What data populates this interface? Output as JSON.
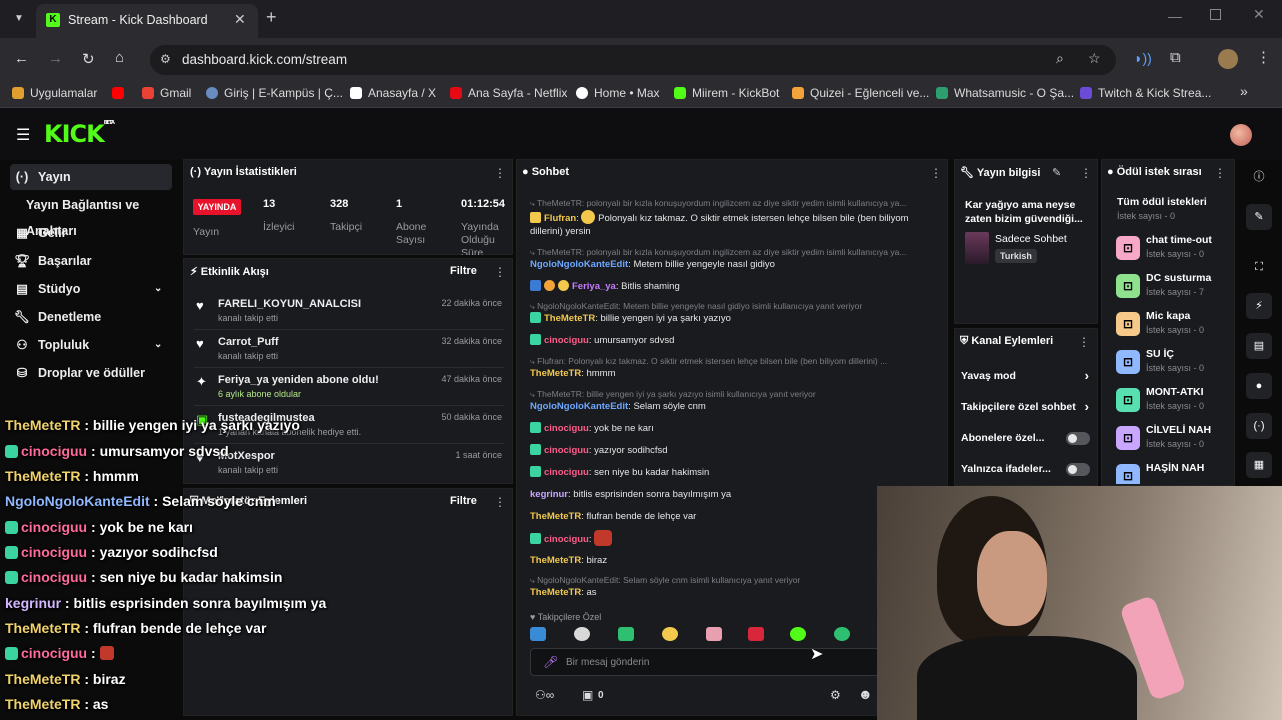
{
  "browser": {
    "tab_title": "Stream - Kick Dashboard",
    "url": "dashboard.kick.com/stream",
    "bookmarks": [
      "Uygulamalar",
      "",
      "Gmail",
      "Giriş | E-Kampüs | Ç...",
      "Anasayfa / X",
      "Ana Sayfa - Netflix",
      "Home • Max",
      "Miirem - KickBot",
      "Quizei - Eğlenceli ve...",
      "Whatsamusic - O Şa...",
      "Twitch & Kick Strea..."
    ]
  },
  "brand": {
    "logo": "KICK",
    "beta": "BETA",
    "accent": "#53fc18"
  },
  "sidebar": {
    "items": [
      {
        "label": "Yayın",
        "icon": "broadcast-icon"
      },
      {
        "label": "Yayın Bağlantısı ve Anahtarı",
        "icon": ""
      },
      {
        "label": "Gelir",
        "icon": "revenue-icon"
      },
      {
        "label": "Başarılar",
        "icon": "trophy-icon"
      },
      {
        "label": "Stüdyo",
        "icon": "studio-icon"
      },
      {
        "label": "Denetleme",
        "icon": "wrench-icon"
      },
      {
        "label": "Topluluk",
        "icon": "community-icon"
      },
      {
        "label": "Droplar ve ödüller",
        "icon": "drops-icon"
      }
    ]
  },
  "stats": {
    "title": "Yayın İstatistikleri",
    "live_badge": "YAYINDA",
    "live_label": "Yayın",
    "viewers": "13",
    "viewers_label": "İzleyici",
    "followers": "328",
    "followers_label": "Takipçi",
    "subs": "1",
    "subs_label": "Abone Sayısı",
    "uptime": "01:12:54",
    "uptime_label": "Yayında Olduğu Süre"
  },
  "activity": {
    "title": "Etkinlik Akışı",
    "filter": "Filtre",
    "items": [
      {
        "name": "FARELI_KOYUN_ANALCISI",
        "sub": "kanalı takip etti",
        "time": "22 dakika önce"
      },
      {
        "name": "Carrot_Puff",
        "sub": "kanalı takip etti",
        "time": "32 dakika önce"
      },
      {
        "name": "Feriya_ya yeniden abone oldu!",
        "sub": "6 aylık abone oldular",
        "time": "47 dakika önce"
      },
      {
        "name": "fusteadegilmustea",
        "sub": "1 yanan kanala abonelik hediye etti.",
        "time": "50 dakika önce"
      },
      {
        "name": "MotXespor",
        "sub": "kanalı takip etti",
        "time": "1 saat önce"
      }
    ]
  },
  "mod_actions": {
    "title": "Moderatör Eylemleri",
    "filter": "Filtre"
  },
  "chat": {
    "title": "Sohbet",
    "lines": [
      {
        "type": "reply",
        "text": "⤷ TheMeteTR: polonyalı bir kızla konuşuyordum ingilizcem az diye siktir yedim isimli kullanıcıya ya..."
      },
      {
        "type": "msg",
        "user": "Flufran",
        "color": "#f2c94c",
        "text": "Polonyalı kız takmaz. O siktir etmek istersen lehçe bilsen bile (ben biliyom dillerini) yersin"
      },
      {
        "type": "reply",
        "text": "⤷ TheMeteTR: polonyalı bir kızla konuşuyordum ingilizcem az diye siktir yedim isimli kullanıcıya ya..."
      },
      {
        "type": "msg",
        "user": "NgoloNgoloKanteEdit",
        "color": "#6ea8ff",
        "text": "Metem billie yengeyle nasıl gidiyo"
      },
      {
        "type": "msg",
        "user": "Feriya_ya",
        "color": "#c77dff",
        "text": "Bitlis shaming"
      },
      {
        "type": "reply",
        "text": "⤷ NgoloNgoloKanteEdit: Metem billie yengeyle nasıl gidiyo isimli kullanıcıya yanıt veriyor"
      },
      {
        "type": "msg",
        "user": "TheMeteTR",
        "color": "#f2c94c",
        "text": "billie yengen iyi ya şarkı yazıyo"
      },
      {
        "type": "msg",
        "user": "cinociguu",
        "color": "#ff5c8a",
        "text": "umursamyor sdvsd"
      },
      {
        "type": "reply",
        "text": "⤷ Flufran: Polonyalı kız takmaz. O siktir etmek istersen lehçe bilsen bile (ben biliyom dillerini) ..."
      },
      {
        "type": "msg",
        "user": "TheMeteTR",
        "color": "#f2c94c",
        "text": "hmmm"
      },
      {
        "type": "reply",
        "text": "⤷ TheMeteTR: billie yengen iyi ya şarkı yazıyo isimli kullanıcıya yanıt veriyor"
      },
      {
        "type": "msg",
        "user": "NgoloNgoloKanteEdit",
        "color": "#6ea8ff",
        "text": "Selam söyle cnm"
      },
      {
        "type": "msg",
        "user": "cinociguu",
        "color": "#ff5c8a",
        "text": "yok be ne karı"
      },
      {
        "type": "msg",
        "user": "cinociguu",
        "color": "#ff5c8a",
        "text": "yazıyor sodihcfsd"
      },
      {
        "type": "msg",
        "user": "cinociguu",
        "color": "#ff5c8a",
        "text": "sen niye bu kadar hakimsin"
      },
      {
        "type": "msg",
        "user": "kegrinur",
        "color": "#c9a7ff",
        "text": "bitlis esprisinden sonra bayılmışım ya"
      },
      {
        "type": "msg",
        "user": "TheMeteTR",
        "color": "#f2c94c",
        "text": "flufran bende de lehçe var"
      },
      {
        "type": "msg",
        "user": "cinociguu",
        "color": "#ff5c8a",
        "text": ""
      },
      {
        "type": "msg",
        "user": "TheMeteTR",
        "color": "#f2c94c",
        "text": "biraz"
      },
      {
        "type": "reply",
        "text": "⤷ NgoloNgoloKanteEdit: Selam söyle cnm isimli kullanıcıya yanıt veriyor"
      },
      {
        "type": "msg",
        "user": "TheMeteTR",
        "color": "#f2c94c",
        "text": "as"
      }
    ],
    "followers_only": "Takipçilere Özel",
    "placeholder": "Bir mesaj gönderin",
    "count": "0"
  },
  "stream_info": {
    "title": "Yayın bilgisi",
    "stream_title": "Kar yağıyo ama neyse zaten bizim güvendiği...",
    "category": "Sadece Sohbet",
    "language": "Turkish"
  },
  "channel_actions": {
    "title": "Kanal Eylemleri",
    "items": [
      "Yavaş mod",
      "Takipçilere özel sohbet",
      "Abonelere özel...",
      "Yalnızca ifadeler..."
    ]
  },
  "rewards": {
    "title": "Ödül istek sırası",
    "all": "Tüm ödül istekleri",
    "all_count": "İstek sayısı - 0",
    "items": [
      {
        "name": "chat time-out",
        "count": "İstek sayısı - 0",
        "color": "#f7a8c8"
      },
      {
        "name": "DC susturma",
        "count": "İstek sayısı - 7",
        "color": "#8ee28e"
      },
      {
        "name": "Mic kapa",
        "count": "İstek sayısı - 0",
        "color": "#f6c98a"
      },
      {
        "name": "SU İÇ",
        "count": "İstek sayısı - 0",
        "color": "#8fb8ff"
      },
      {
        "name": "MONT-ATKI",
        "count": "İstek sayısı - 0",
        "color": "#58e0b0"
      },
      {
        "name": "CİLVELİ NAH",
        "count": "İstek sayısı - 0",
        "color": "#c9a7ff"
      },
      {
        "name": "HAŞİN NAH",
        "count": "İstek sayısı - 0",
        "color": "#8fb8ff"
      }
    ]
  },
  "overlay_chat": [
    {
      "user": "TheMeteTR",
      "text": " : billie yengen iyi ya şarkı yazıyo",
      "color": "#f2d36b",
      "badge": false
    },
    {
      "user": "cinociguu",
      "text": " : umursamyor sdvsd",
      "color": "#ff6b9a",
      "badge": true
    },
    {
      "user": "TheMeteTR",
      "text": " : hmmm",
      "color": "#f2d36b",
      "badge": false
    },
    {
      "user": "NgoloNgoloKanteEdit",
      "text": " : Selam söyle cnm",
      "color": "#8fb8ff",
      "badge": false
    },
    {
      "user": "cinociguu",
      "text": " : yok be ne karı",
      "color": "#ff6b9a",
      "badge": true
    },
    {
      "user": "cinociguu",
      "text": " : yazıyor sodihcfsd",
      "color": "#ff6b9a",
      "badge": true
    },
    {
      "user": "cinociguu",
      "text": " : sen niye bu kadar hakimsin",
      "color": "#ff6b9a",
      "badge": true
    },
    {
      "user": "kegrinur",
      "text": " : bitlis esprisinden sonra bayılmışım ya",
      "color": "#d4b8ff",
      "badge": false
    },
    {
      "user": "TheMeteTR",
      "text": " : flufran bende de lehçe var",
      "color": "#f2d36b",
      "badge": false
    },
    {
      "user": "cinociguu",
      "text": " : ",
      "color": "#ff6b9a",
      "badge": true
    },
    {
      "user": "TheMeteTR",
      "text": " : biraz",
      "color": "#f2d36b",
      "badge": false
    },
    {
      "user": "TheMeteTR",
      "text": " : as",
      "color": "#f2d36b",
      "badge": false
    }
  ]
}
